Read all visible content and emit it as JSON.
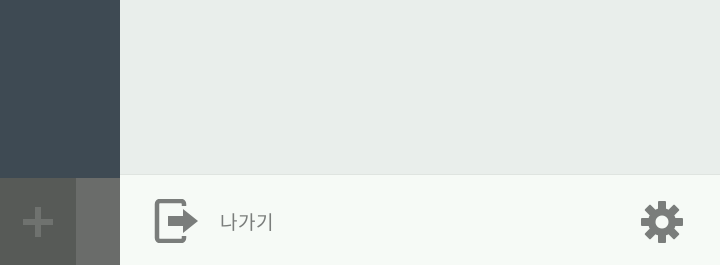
{
  "footer": {
    "exit_label": "나가기"
  },
  "icons": {
    "add": "plus-icon",
    "exit": "exit-icon",
    "settings": "gear-icon"
  },
  "colors": {
    "sidebar": "#3e4a53",
    "add_tile": "#575a57",
    "icon_gray": "#7a7d7b",
    "footer_bg": "#f6faf6",
    "main_bg": "#e9eeeb"
  }
}
